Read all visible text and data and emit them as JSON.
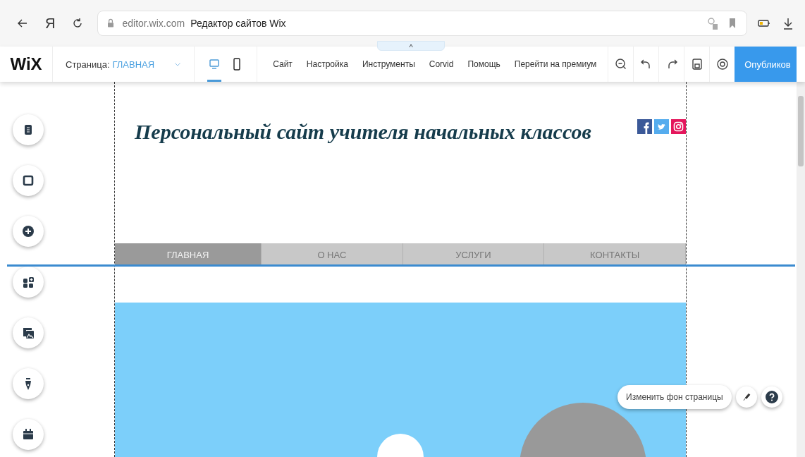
{
  "browser": {
    "yandex_button": "Я",
    "host": "editor.wix.com",
    "page_title": "Редактор сайтов Wix"
  },
  "editor": {
    "logo": "WiX",
    "page_label": "Страница:",
    "page_name": "ГЛАВНАЯ",
    "collapse_tab": "^",
    "devices": [
      {
        "kind": "desktop",
        "selected": true
      },
      {
        "kind": "mobile",
        "selected": false
      }
    ],
    "menu": [
      "Сайт",
      "Настройка",
      "Инструменты",
      "Corvid",
      "Помощь",
      "Перейти на премиум"
    ],
    "actions": [
      {
        "kind": "zoom"
      },
      {
        "kind": "undo"
      },
      {
        "kind": "redo"
      },
      {
        "kind": "save"
      },
      {
        "kind": "preview"
      }
    ],
    "publish": "Опубликов"
  },
  "left_tools": [
    {
      "kind": "pages"
    },
    {
      "kind": "background"
    },
    {
      "kind": "add"
    },
    {
      "kind": "apps"
    },
    {
      "kind": "media"
    },
    {
      "kind": "blog"
    },
    {
      "kind": "calendar"
    }
  ],
  "site": {
    "title": "Персональный сайт учителя начальных классов",
    "social": [
      {
        "kind": "facebook"
      },
      {
        "kind": "twitter"
      },
      {
        "kind": "instagram"
      }
    ],
    "nav": [
      {
        "label": "ГЛАВНАЯ",
        "selected": true
      },
      {
        "label": "О НАС",
        "selected": false
      },
      {
        "label": "УСЛУГИ",
        "selected": false
      },
      {
        "label": "КОНТАКТЫ",
        "selected": false
      }
    ]
  },
  "page_background": {
    "label": "Изменить фон страницы"
  }
}
